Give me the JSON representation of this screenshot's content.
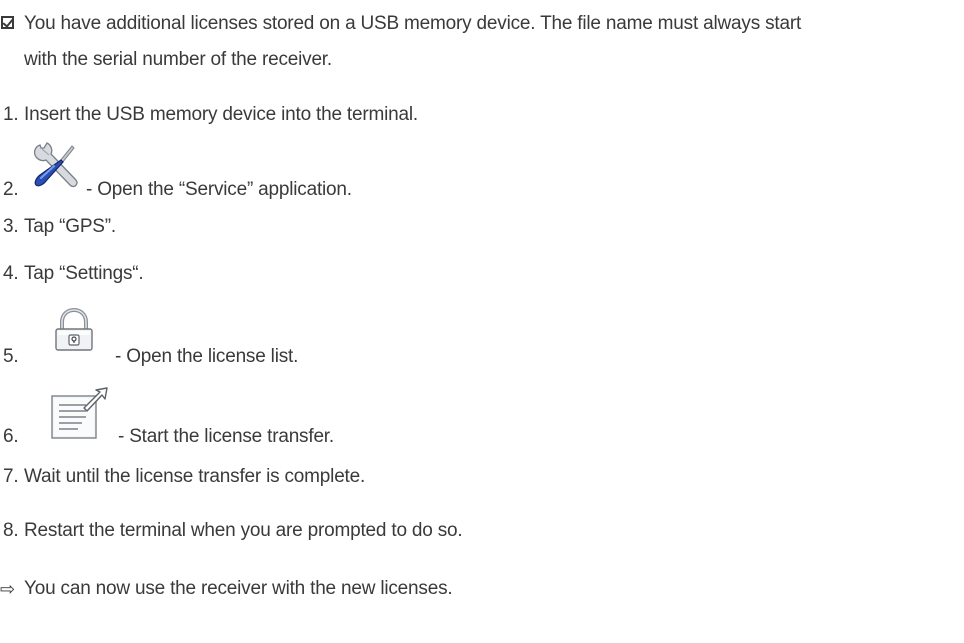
{
  "prerequisite": {
    "line1": "You have additional licenses stored on a USB memory device. The file name must always start",
    "line2": "with the serial number of the receiver."
  },
  "steps": [
    {
      "num": "1.",
      "text": "Insert the USB memory device into the terminal."
    },
    {
      "num": "2.",
      "text": "- Open the “Service” application.",
      "icon": "service-tools-icon"
    },
    {
      "num": "3.",
      "text": "Tap “GPS”."
    },
    {
      "num": "4.",
      "text": "Tap “Settings“."
    },
    {
      "num": "5.",
      "text": "- Open the license list.",
      "icon": "padlock-icon"
    },
    {
      "num": "6.",
      "text": "- Start the license transfer.",
      "icon": "license-transfer-icon"
    },
    {
      "num": "7.",
      "text": "Wait until the license transfer is complete."
    },
    {
      "num": "8.",
      "text": "Restart the terminal when you are prompted to do so."
    }
  ],
  "result": {
    "arrow": "⇨",
    "text": "You can now use the receiver with the new licenses."
  }
}
